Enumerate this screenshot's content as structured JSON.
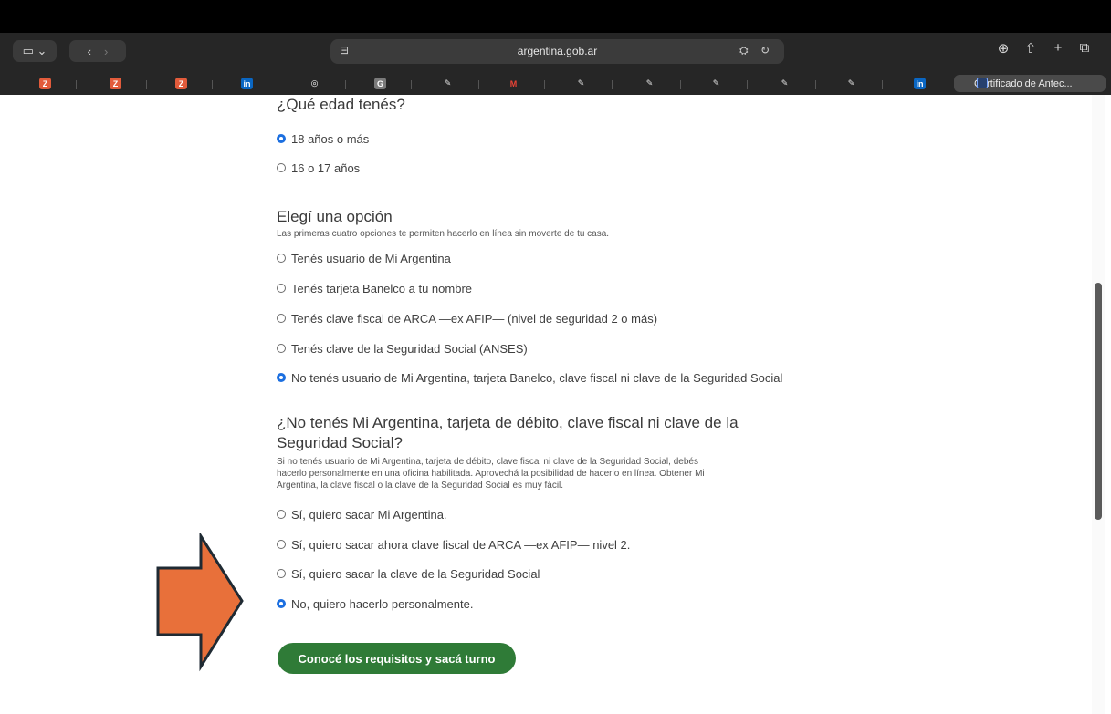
{
  "browser": {
    "url": "argentina.gob.ar",
    "active_tab": "Certificado de Antec...",
    "bookmarks": [
      {
        "icon": "zendesk-icon",
        "color": "#e25b3b",
        "glyph": "Z"
      },
      {
        "icon": "zendesk-icon",
        "color": "#e25b3b",
        "glyph": "Z"
      },
      {
        "icon": "zendesk-icon",
        "color": "#e25b3b",
        "glyph": "Z"
      },
      {
        "icon": "linkedin-icon",
        "color": "#0a66c2",
        "glyph": "in"
      },
      {
        "icon": "openai-icon",
        "color": "#ffffff",
        "glyph": "◎"
      },
      {
        "icon": "app-icon",
        "color": "#7a7a7a",
        "glyph": "G"
      },
      {
        "icon": "feather-icon",
        "color": "#e0e0e0",
        "glyph": "✎"
      },
      {
        "icon": "gmail-icon",
        "color": "#ea4335",
        "glyph": "M"
      },
      {
        "icon": "feather-icon",
        "color": "#e0e0e0",
        "glyph": "✎"
      },
      {
        "icon": "feather-icon",
        "color": "#e0e0e0",
        "glyph": "✎"
      },
      {
        "icon": "feather-icon",
        "color": "#e0e0e0",
        "glyph": "✎"
      },
      {
        "icon": "feather-icon",
        "color": "#e0e0e0",
        "glyph": "✎"
      },
      {
        "icon": "feather-icon",
        "color": "#e0e0e0",
        "glyph": "✎"
      },
      {
        "icon": "linkedin-icon",
        "color": "#0a66c2",
        "glyph": "in"
      }
    ]
  },
  "form": {
    "age": {
      "title": "¿Qué edad tenés?",
      "options": [
        {
          "label": "18 años o más",
          "selected": true
        },
        {
          "label": "16 o 17 años",
          "selected": false
        }
      ]
    },
    "option": {
      "title": "Elegí una opción",
      "subtitle": "Las primeras cuatro opciones te permiten hacerlo en línea sin moverte de tu casa.",
      "options": [
        {
          "label": "Tenés usuario de Mi Argentina",
          "selected": false
        },
        {
          "label": "Tenés tarjeta Banelco a tu nombre",
          "selected": false
        },
        {
          "label": "Tenés clave fiscal de ARCA —ex AFIP— (nivel de seguridad 2 o más)",
          "selected": false
        },
        {
          "label": "Tenés clave de la Seguridad Social (ANSES)",
          "selected": false
        },
        {
          "label": "No tenés usuario de Mi Argentina, tarjeta Banelco, clave fiscal ni clave de la Seguridad Social",
          "selected": true
        }
      ]
    },
    "no_credentials": {
      "title_line1": "¿No tenés Mi Argentina, tarjeta de débito, clave fiscal ni clave de la",
      "title_line2": "Seguridad Social?",
      "subtitle_line1": "Si no tenés usuario de Mi Argentina, tarjeta de débito, clave fiscal ni clave de la Seguridad Social, debés",
      "subtitle_line2": "hacerlo personalmente en una oficina habilitada. Aprovechá la posibilidad de hacerlo en línea. Obtener Mi",
      "subtitle_line3": "Argentina, la clave fiscal o la clave de la Seguridad Social es muy fácil.",
      "options": [
        {
          "label": "Sí, quiero sacar Mi Argentina.",
          "selected": false
        },
        {
          "label": "Sí, quiero sacar ahora clave fiscal de ARCA —ex AFIP— nivel 2.",
          "selected": false
        },
        {
          "label": "Sí, quiero sacar la clave de la Seguridad Social",
          "selected": false
        },
        {
          "label": "No, quiero hacerlo personalmente.",
          "selected": true
        }
      ]
    },
    "cta_label": "Conocé los requisitos y sacá turno"
  },
  "colors": {
    "accent": "#1c6fe0",
    "button": "#2f7b37",
    "arrow": "#e8703a"
  }
}
